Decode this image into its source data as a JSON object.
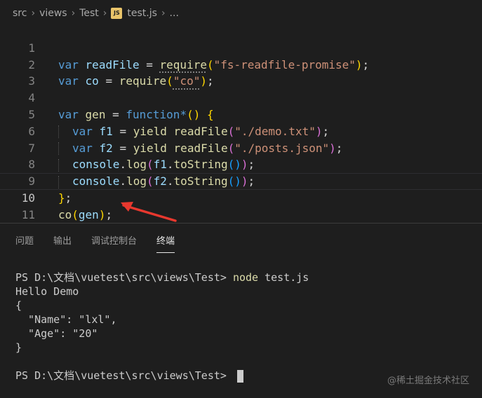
{
  "breadcrumb": {
    "items": [
      "src",
      "views",
      "Test",
      "test.js",
      "..."
    ],
    "js_badge": "JS"
  },
  "editor": {
    "lines": [
      {
        "num": "1"
      },
      {
        "num": "2"
      },
      {
        "num": "3"
      },
      {
        "num": "4"
      },
      {
        "num": "5"
      },
      {
        "num": "6"
      },
      {
        "num": "7"
      },
      {
        "num": "8"
      },
      {
        "num": "9"
      },
      {
        "num": "10"
      },
      {
        "num": "11"
      }
    ]
  },
  "panel": {
    "tabs": [
      "问题",
      "输出",
      "调试控制台",
      "终端"
    ],
    "active_tab": "终端"
  },
  "terminal": {
    "prompt": "PS D:\\文档\\vuetest\\src\\views\\Test> ",
    "command": "node",
    "command_arg": " test.js",
    "output": [
      "Hello Demo",
      "{",
      "  \"Name\": \"lxl\",",
      "  \"Age\": \"20\"",
      "}"
    ],
    "prompt2": "PS D:\\文档\\vuetest\\src\\views\\Test> "
  },
  "watermark": "@稀土掘金技术社区",
  "colors": {
    "background": "#1e1e1e",
    "keyword": "#569cd6",
    "variable": "#9cdcfe",
    "function": "#dcdcaa",
    "string": "#ce9178",
    "arrow": "#e8382e"
  }
}
